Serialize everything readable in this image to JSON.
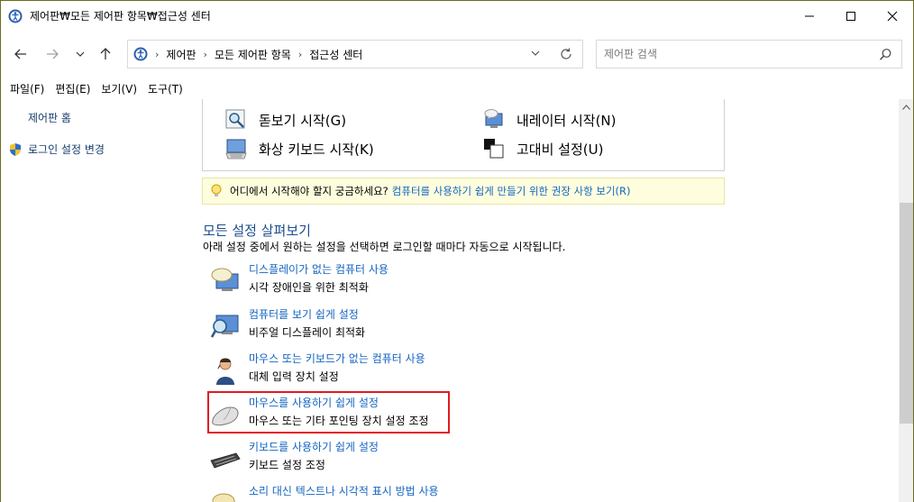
{
  "window": {
    "title": "제어판₩모든 제어판 항목₩접근성 센터"
  },
  "address": {
    "crumbs": [
      "제어판",
      "모든 제어판 항목",
      "접근성 센터"
    ]
  },
  "search": {
    "placeholder": "제어판 검색"
  },
  "menu": {
    "items": [
      "파일(F)",
      "편집(E)",
      "보기(V)",
      "도구(T)"
    ]
  },
  "sidebar": {
    "home": "제어판 홈",
    "login": "로그인 설정 변경"
  },
  "tools": {
    "magnifier": "돋보기 시작(G)",
    "narrator": "내레이터 시작(N)",
    "keyboard": "화상 키보드 시작(K)",
    "contrast": "고대비 설정(U)"
  },
  "tip": {
    "question": "어디에서 시작해야 할지 궁금하세요?",
    "link": "컴퓨터를 사용하기 쉽게 만들기 위한 권장 사항 보기(R)"
  },
  "section": {
    "title": "모든 설정 살펴보기",
    "desc": "아래 설정 중에서 원하는 설정을 선택하면 로그인할 때마다 자동으로 시작됩니다."
  },
  "options": [
    {
      "link": "디스플레이가 없는 컴퓨터 사용",
      "desc": "시각 장애인을 위한 최적화"
    },
    {
      "link": "컴퓨터를 보기 쉽게 설정",
      "desc": "비주얼 디스플레이 최적화"
    },
    {
      "link": "마우스 또는 키보드가 없는 컴퓨터 사용",
      "desc": "대체 입력 장치 설정"
    },
    {
      "link": "마우스를 사용하기 쉽게 설정",
      "desc": "마우스 또는 기타 포인팅 장치 설정 조정"
    },
    {
      "link": "키보드를 사용하기 쉽게 설정",
      "desc": "키보드 설정 조정"
    },
    {
      "link": "소리 대신 텍스트나 시각적 표시 방법 사용",
      "desc": ""
    }
  ],
  "colors": {
    "link": "#1565c0",
    "highlight": "#e11b22",
    "tip_bg": "#fefede"
  }
}
